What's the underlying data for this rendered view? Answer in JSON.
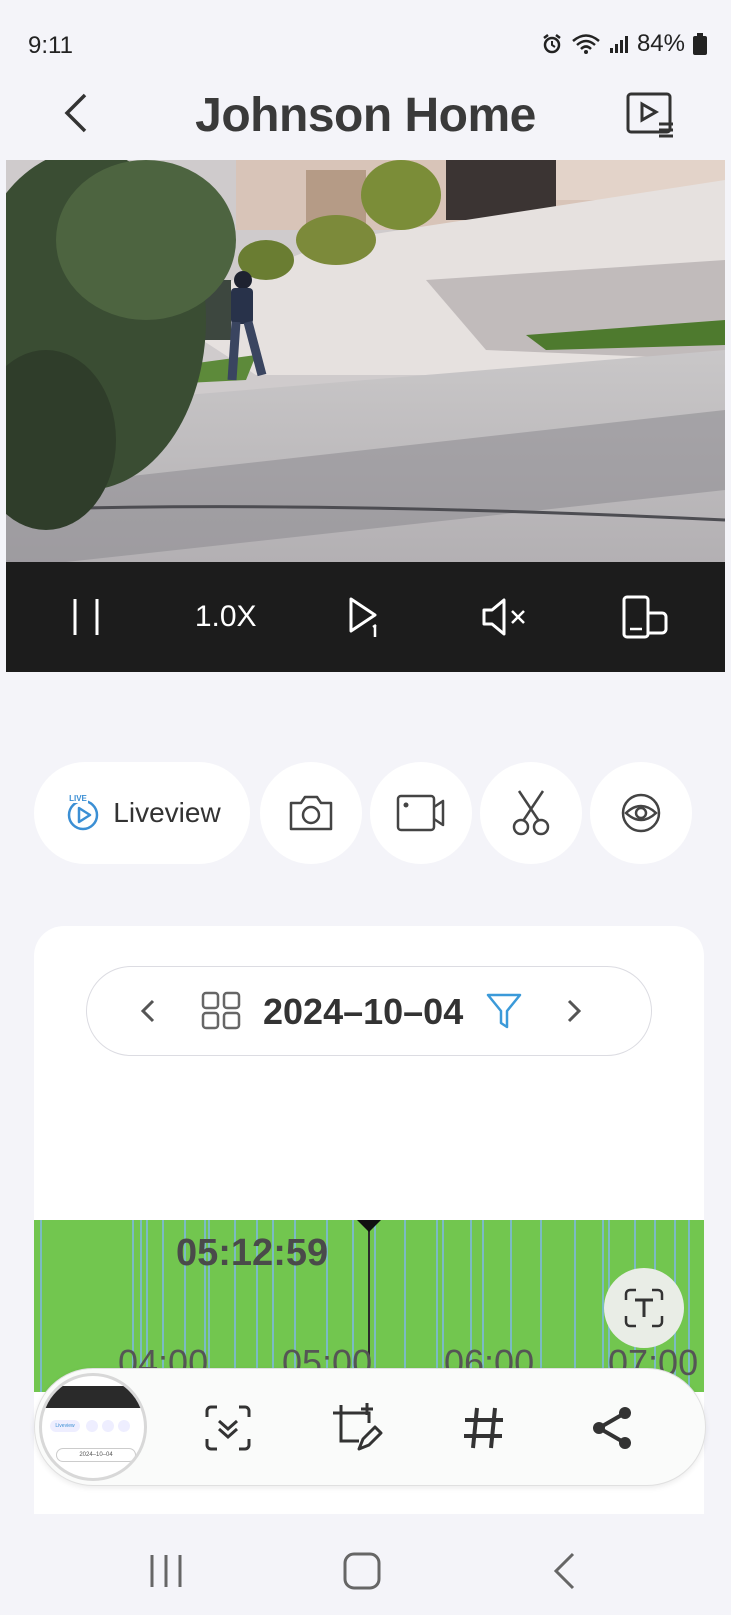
{
  "status_bar": {
    "time": "9:11",
    "battery": "84%",
    "icons": [
      "alarm-icon",
      "wifi-icon",
      "signal-icon",
      "battery-icon"
    ]
  },
  "header": {
    "title": "Johnson Home",
    "back_icon": "chevron-left-icon",
    "playlist_icon": "playlist-play-icon"
  },
  "controls": {
    "pause_icon": "pause-icon",
    "speed": "1.0X",
    "play_step_icon": "play-step-icon",
    "mute_icon": "speaker-muted-icon",
    "rotate_icon": "rotate-device-icon"
  },
  "actions": {
    "liveview_badge": "LIVE",
    "liveview_label": "Liveview",
    "icons": [
      "camera-icon",
      "video-record-icon",
      "scissors-icon",
      "eye-icon"
    ]
  },
  "date_bar": {
    "date": "2024–10–04",
    "prev_icon": "chevron-left-icon",
    "next_icon": "chevron-right-icon",
    "grid_icon": "grid-icon",
    "filter_icon": "filter-icon"
  },
  "timeline": {
    "current_time": "05:12:59",
    "ticks": [
      "04:00",
      "05:00",
      "06:00",
      "07:00"
    ],
    "colors": {
      "recorded": "#72c64f",
      "event": "#7cb8d8"
    }
  },
  "screenshot_toolbar": {
    "icons": [
      "scroll-capture-icon",
      "crop-edit-icon",
      "hashtag-icon",
      "share-icon"
    ],
    "text_scan_icon": "text-scan-icon",
    "thumb_date": "2024–10–04",
    "thumb_liveview": "Liveview"
  },
  "navbar": {
    "icons": [
      "recent-apps-icon",
      "home-icon",
      "back-icon"
    ]
  }
}
